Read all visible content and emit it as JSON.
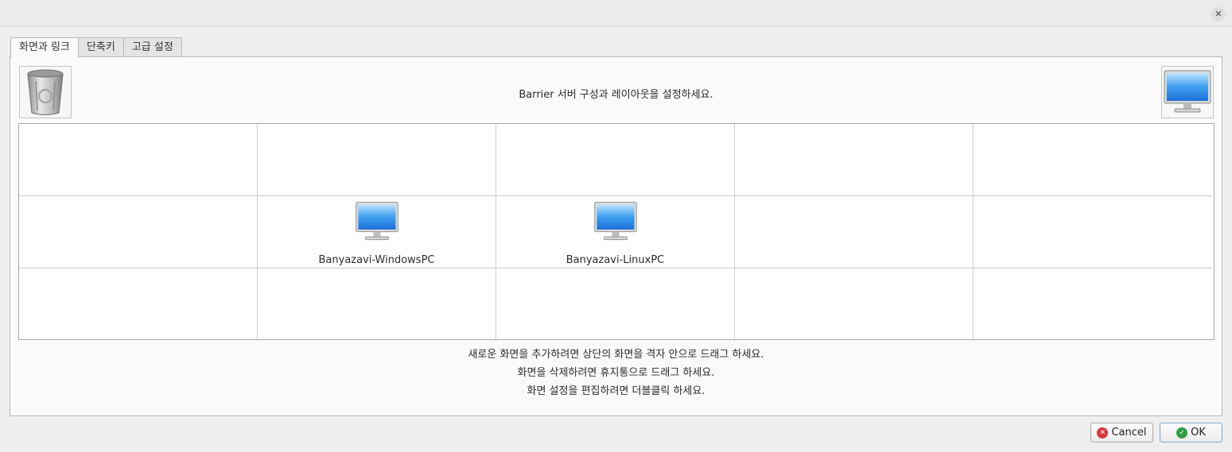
{
  "window": {
    "close_symbol": "✕"
  },
  "tabs": [
    {
      "label": "화면과 링크",
      "active": true
    },
    {
      "label": "단축키",
      "active": false
    },
    {
      "label": "고급 설정",
      "active": false
    }
  ],
  "header": {
    "text": "Barrier 서버 구성과 레이아웃을 설정하세요.",
    "trash_icon": "trash-can-icon",
    "new_screen_icon": "monitor-icon"
  },
  "grid": {
    "columns": 5,
    "rows": 3,
    "screens": [
      {
        "name": "Banyazavi-WindowsPC",
        "row": 1,
        "col": 1,
        "icon": "monitor-icon"
      },
      {
        "name": "Banyazavi-LinuxPC",
        "row": 1,
        "col": 2,
        "icon": "monitor-icon"
      }
    ]
  },
  "help_lines": [
    "새로운 화면을 추가하려면 상단의 화면을 격자 안으로 드래그 하세요.",
    "화면을 삭제하려면 휴지통으로 드래그 하세요.",
    "화면 설정을 편집하려면 더블클릭 하세요."
  ],
  "buttons": {
    "cancel": {
      "label": "Cancel",
      "icon": "cancel-icon",
      "icon_color": "#d9363e"
    },
    "ok": {
      "label": "OK",
      "icon": "check-icon",
      "icon_color": "#2e9e44"
    }
  }
}
